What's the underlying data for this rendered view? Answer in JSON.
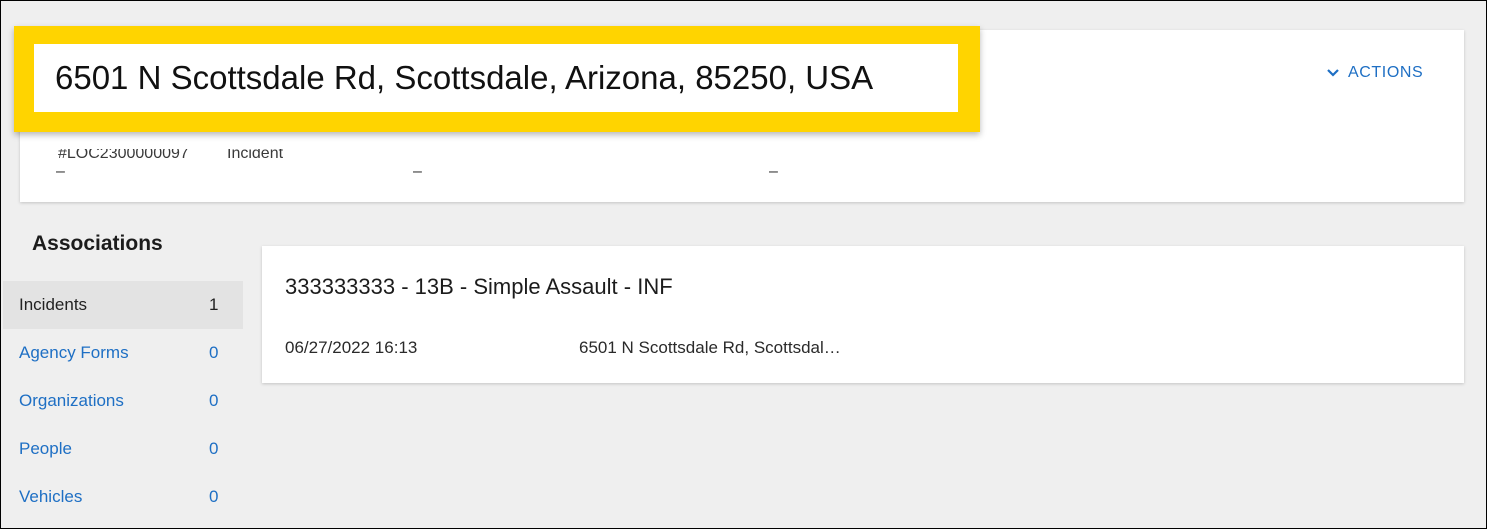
{
  "header": {
    "title": "6501 N Scottsdale Rd, Scottsdale, Arizona, 85250, USA",
    "record_id": "#LOC2300000097",
    "record_type": "Incident",
    "field_values": [
      "–",
      "–",
      "–"
    ],
    "actions_label": "ACTIONS",
    "actions_icon": "chevron-down-icon"
  },
  "highlight": {
    "color": "#ffd400"
  },
  "associations": {
    "heading": "Associations",
    "items": [
      {
        "label": "Incidents",
        "count": "1",
        "active": true
      },
      {
        "label": "Agency Forms",
        "count": "0",
        "active": false
      },
      {
        "label": "Organizations",
        "count": "0",
        "active": false
      },
      {
        "label": "People",
        "count": "0",
        "active": false
      },
      {
        "label": "Vehicles",
        "count": "0",
        "active": false
      }
    ]
  },
  "incident": {
    "title": "333333333 - 13B - Simple Assault - INF",
    "date": "06/27/2022 16:13",
    "address": "6501 N Scottsdale Rd, Scottsdal…"
  },
  "colors": {
    "link": "#1e6fc4",
    "background": "#efefef",
    "card": "#ffffff"
  }
}
